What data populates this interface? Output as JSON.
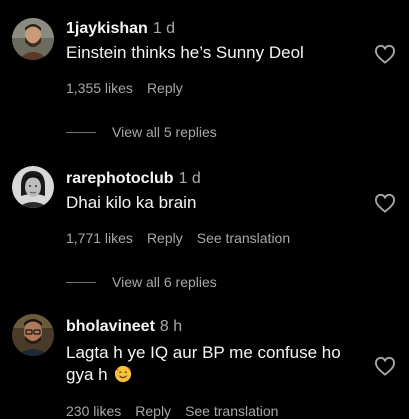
{
  "comments": [
    {
      "username": "1jaykishan",
      "time": "1 d",
      "text": "Einstein thinks he’s Sunny Deol",
      "likes": "1,355 likes",
      "reply_label": "Reply",
      "view_replies": "View all 5 replies",
      "avatar_icon": "user-avatar-man-with-beard"
    },
    {
      "username": "rarephotoclub",
      "time": "1 d",
      "text": "Dhai kilo ka brain",
      "likes": "1,771 likes",
      "reply_label": "Reply",
      "translation_label": "See translation",
      "view_replies": "View all 6 replies",
      "avatar_icon": "user-avatar-vintage-portrait"
    },
    {
      "username": "bholavineet",
      "time": "8 h",
      "text": "Lagta h ye IQ aur BP me confuse ho gya h",
      "emoji": "smiling-face-with-hearts",
      "likes": "230 likes",
      "reply_label": "Reply",
      "translation_label": "See translation",
      "avatar_icon": "user-avatar-man-with-glasses"
    }
  ],
  "icons": {
    "like": "heart-outline-icon"
  },
  "colors": {
    "background": "#000000",
    "primary_text": "#f5f5f5",
    "secondary_text": "#a8a8a8",
    "divider": "#737373"
  }
}
